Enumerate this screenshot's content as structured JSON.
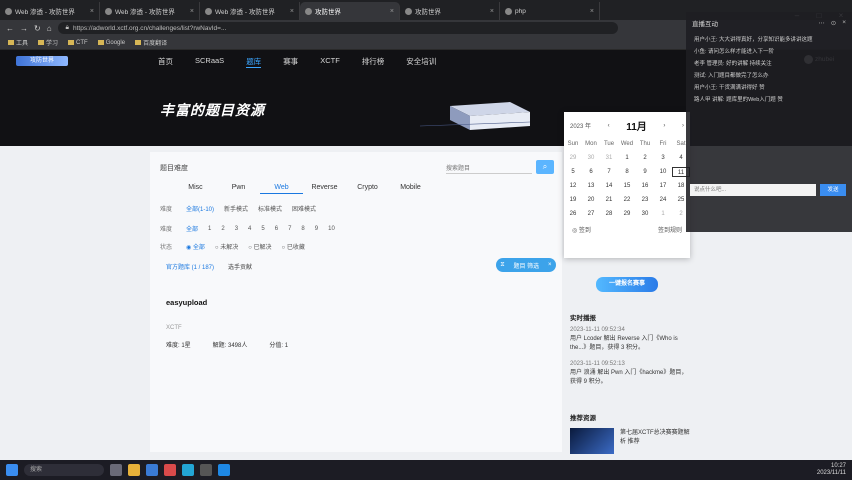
{
  "browser": {
    "tabs": [
      {
        "label": "Web 渗透 - 攻防世界",
        "active": false
      },
      {
        "label": "Web 渗透 - 攻防世界",
        "active": false
      },
      {
        "label": "Web 渗透 - 攻防世界",
        "active": false
      },
      {
        "label": "攻防世界",
        "active": true
      },
      {
        "label": "攻防世界",
        "active": false
      },
      {
        "label": "php",
        "active": false
      }
    ],
    "url": "https://adworld.xctf.org.cn/challenges/list?rwNavId=...",
    "bookmarks": [
      "工具",
      "学习",
      "CTF",
      "Google",
      "百度翻译"
    ]
  },
  "site": {
    "logo": "攻防世界",
    "nav": [
      "首页",
      "SCRaaS",
      "题库",
      "赛事",
      "XCTF",
      "排行榜",
      "安全培训"
    ],
    "nav_active": "题库",
    "user_name": "zhubei"
  },
  "hero": {
    "title": "丰富的题目资源"
  },
  "panel": {
    "section_title": "题目难度",
    "search_placeholder": "搜索题目",
    "search_btn": "⌕",
    "categories": [
      "Misc",
      "Pwn",
      "Web",
      "Reverse",
      "Crypto",
      "Mobile"
    ],
    "category_active": "Web",
    "filters": [
      {
        "label": "难度",
        "items": [
          "全部(1-10)",
          "新手模式",
          "标准模式",
          "困难模式"
        ],
        "active": "全部(1-10)"
      },
      {
        "label": "难度",
        "items": [
          "全部",
          "1",
          "2",
          "3",
          "4",
          "5",
          "6",
          "7",
          "8",
          "9",
          "10"
        ],
        "active": "全部"
      },
      {
        "label": "状态",
        "items": [
          "全部",
          "未解决",
          "已解决",
          "已收藏"
        ],
        "active": "全部"
      }
    ],
    "sub_tabs": [
      "官方题库 (1 / 187)",
      "选手贡献"
    ],
    "sub_tab_active": "官方题库 (1 / 187)",
    "pill_label": "题目 筛选",
    "problem": {
      "title": "easyupload",
      "tag": "XCTF",
      "meta": [
        "难度: 1星",
        "解题: 3498人",
        "分值: 1"
      ]
    }
  },
  "calendar": {
    "year": "2023 年",
    "month": "11月",
    "weekdays": [
      "Sun",
      "Mon",
      "Tue",
      "Wed",
      "Thu",
      "Fri",
      "Sat"
    ],
    "days": [
      "29",
      "30",
      "31",
      "1",
      "2",
      "3",
      "4",
      "5",
      "6",
      "7",
      "8",
      "9",
      "10",
      "11",
      "12",
      "13",
      "14",
      "15",
      "16",
      "17",
      "18",
      "19",
      "20",
      "21",
      "22",
      "23",
      "24",
      "25",
      "26",
      "27",
      "28",
      "29",
      "30",
      "1",
      "2"
    ],
    "today": "11",
    "foot_left": "◎ 签到",
    "foot_right": "签到规则"
  },
  "right": {
    "cta": "一键报名赛事",
    "news_title": "实时播报",
    "news": [
      {
        "time": "2023-11-11 09:52:34",
        "text": "用户 Lcoder 解出 Reverse 入门《Who is the...》题目，获得 3 积分。"
      },
      {
        "time": "2023-11-11 09:52:13",
        "text": "用户 浪涌 解出 Pwn 入门《hackme》题目，获得 9 积分。"
      }
    ],
    "rec_title": "推荐资源",
    "rec_text": "第七届XCTF总决赛赛题解析 推荐"
  },
  "chat": {
    "title": "直播互动",
    "messages": [
      "用户小王: 大大讲得真好，分享知识能多讲讲这题",
      "小鱼: 请问怎么样才能进入下一阶",
      "老李 管理员: 好的讲解 持续关注",
      "测试: 入门题目都做完了怎么办",
      "用户小王: 干货满满讲得好 赞",
      "路人甲 讲解: 题库里的Web入门题 赞"
    ],
    "input_placeholder": "说点什么吧...",
    "send": "发送"
  },
  "taskbar": {
    "search": "搜索",
    "time": "10:27",
    "date": "2023/11/11"
  }
}
